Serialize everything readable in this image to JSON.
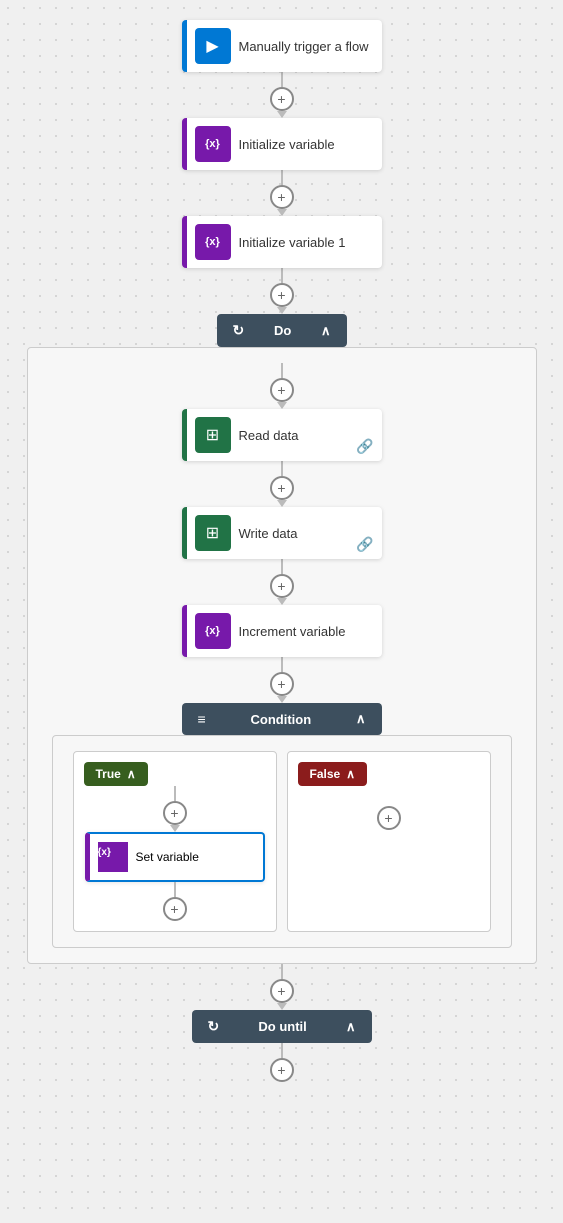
{
  "nodes": {
    "trigger": {
      "label": "Manually trigger a flow",
      "icon": "▶",
      "iconBg": "#0078d4"
    },
    "initVar": {
      "label": "Initialize variable",
      "icon": "{x}",
      "iconBg": "#7719aa"
    },
    "initVar1": {
      "label": "Initialize variable 1",
      "icon": "{x}",
      "iconBg": "#7719aa"
    },
    "doBlock": {
      "label": "Do",
      "chevron": "∧"
    },
    "readData": {
      "label": "Read data",
      "icon": "⊞",
      "iconBg": "#217346"
    },
    "writeData": {
      "label": "Write data",
      "icon": "⊞",
      "iconBg": "#217346"
    },
    "incrementVar": {
      "label": "Increment variable",
      "icon": "{x}",
      "iconBg": "#7719aa"
    },
    "condition": {
      "label": "Condition",
      "chevron": "∧",
      "trueLabel": "True",
      "trueChevron": "∧",
      "falseLabel": "False",
      "falseChevron": "∧"
    },
    "setVariable": {
      "label": "Set variable",
      "icon": "{x}",
      "iconBg": "#7719aa"
    },
    "doUntil": {
      "label": "Do until",
      "chevron": "∧"
    }
  },
  "plus_label": "+",
  "link_icon": "🔗",
  "condition_icon": "≡",
  "do_icon": "↻",
  "do_until_icon": "↻"
}
